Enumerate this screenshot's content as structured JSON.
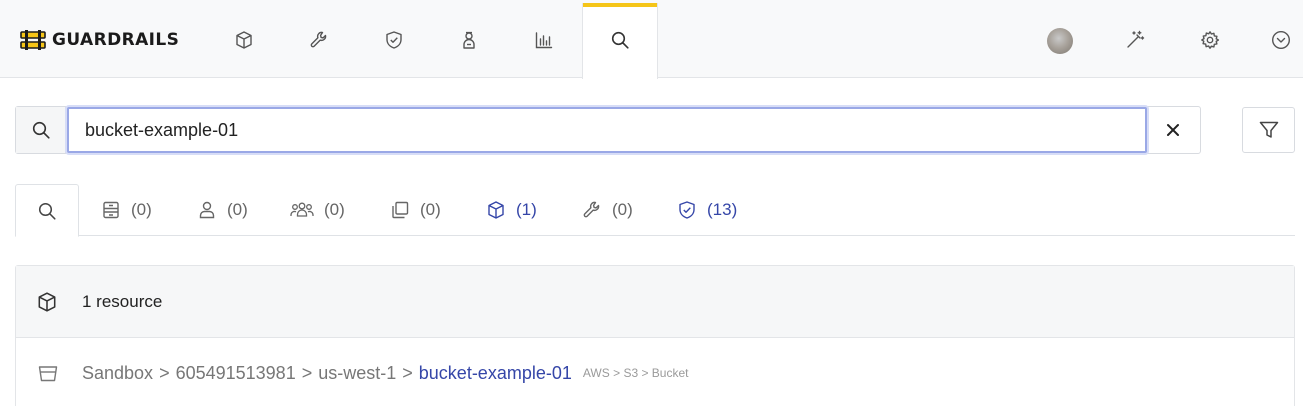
{
  "app": {
    "name": "GUARDRAILS",
    "brand_color": "#f5c518"
  },
  "nav": {
    "items": [
      {
        "name": "resources",
        "icon": "cube-icon"
      },
      {
        "name": "controls",
        "icon": "wrench-icon"
      },
      {
        "name": "policies",
        "icon": "shield-check-icon"
      },
      {
        "name": "activity",
        "icon": "person-badge-icon"
      },
      {
        "name": "reports",
        "icon": "bar-chart-icon"
      },
      {
        "name": "search",
        "icon": "search-icon",
        "active": true
      }
    ],
    "right": [
      "avatar",
      "magic-wand-icon",
      "gear-icon",
      "chevron-down-circle-icon"
    ]
  },
  "search": {
    "value": "bucket-example-01",
    "placeholder": ""
  },
  "tabs": [
    {
      "icon": "search-icon",
      "count": ""
    },
    {
      "icon": "server-icon",
      "count": "(0)"
    },
    {
      "icon": "person-icon",
      "count": "(0)"
    },
    {
      "icon": "people-icon",
      "count": "(0)"
    },
    {
      "icon": "copy-icon",
      "count": "(0)"
    },
    {
      "icon": "cube-icon",
      "count": "(1)"
    },
    {
      "icon": "wrench-icon",
      "count": "(0)"
    },
    {
      "icon": "shield-check-icon",
      "count": "(13)"
    }
  ],
  "results": {
    "header": "1 resource",
    "rows": [
      {
        "path": [
          "Sandbox",
          "605491513981",
          "us-west-1"
        ],
        "name": "bucket-example-01",
        "type": "AWS > S3 > Bucket"
      }
    ]
  }
}
